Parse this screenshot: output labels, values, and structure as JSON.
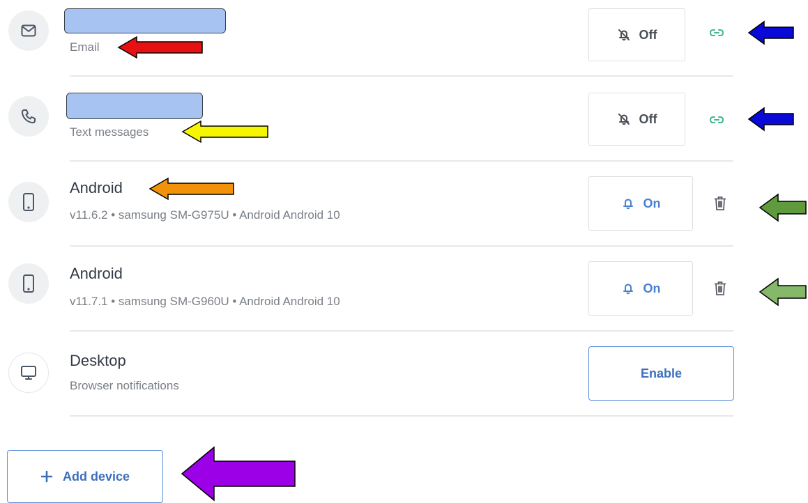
{
  "rows": [
    {
      "subtitle": "Email",
      "toggle_label": "Off"
    },
    {
      "subtitle": "Text messages",
      "toggle_label": "Off"
    },
    {
      "title": "Android",
      "subtitle": "v11.6.2 • samsung SM-G975U • Android Android 10",
      "toggle_label": "On"
    },
    {
      "title": "Android",
      "subtitle": "v11.7.1 • samsung SM-G960U • Android Android 10",
      "toggle_label": "On"
    },
    {
      "title": "Desktop",
      "subtitle": "Browser notifications",
      "button_label": "Enable"
    }
  ],
  "add_device": {
    "label": "Add device"
  },
  "icons": {
    "email": "envelope-icon",
    "phone": "phone-icon",
    "mobile": "mobile-device-icon",
    "desktop": "monitor-icon",
    "bell_off": "bell-off-icon",
    "bell_on": "bell-icon",
    "link": "link-icon",
    "trash": "trash-icon",
    "plus": "plus-icon"
  },
  "colors": {
    "accent": "#4a7fd0",
    "link_green": "#3fb889",
    "redaction": "#a7c3f2",
    "arrow_red": "#e81010",
    "arrow_yellow": "#f6f600",
    "arrow_orange": "#f2920a",
    "arrow_blue": "#0a0ad8",
    "arrow_green_dark": "#5f9a3c",
    "arrow_green_light": "#86b86a",
    "arrow_purple": "#9b00e6"
  }
}
